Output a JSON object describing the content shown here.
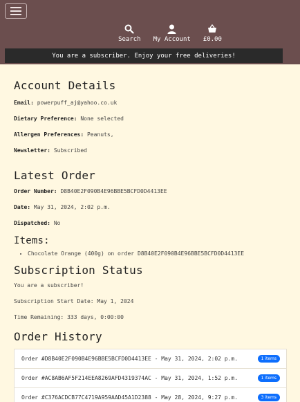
{
  "header": {
    "nav": [
      {
        "label": "Search",
        "icon": "search-icon"
      },
      {
        "label": "My Account",
        "icon": "user-icon"
      },
      {
        "label": "£0.00",
        "icon": "basket-icon"
      }
    ],
    "banner": "You are a subscriber. Enjoy your free deliveries!"
  },
  "account": {
    "title": "Account Details",
    "email_label": "Email:",
    "email": "powerpuff_aj@yahoo.co.uk",
    "diet_label": "Dietary Preference:",
    "diet": "None selected",
    "allergen_label": "Allergen Preferences:",
    "allergen": "Peanuts,",
    "newsletter_label": "Newsletter:",
    "newsletter": "Subscribed"
  },
  "latest_order": {
    "title": "Latest Order",
    "number_label": "Order Number:",
    "number": "D8B40E2F090B4E96BBE5BCFD0D4413EE",
    "date_label": "Date:",
    "date": "May 31, 2024, 2:02 p.m.",
    "dispatched_label": "Dispatched:",
    "dispatched": "No",
    "items_title": "Items:",
    "items": [
      "Chocolate Orange (400g) on order D8B40E2F090B4E96BBE5BCFD0D4413EE"
    ]
  },
  "subscription": {
    "title": "Subscription Status",
    "status": "You are a subscriber!",
    "start": "Subscription Start Date: May 1, 2024",
    "remaining": "Time Remaining: 333 days, 0:00:00"
  },
  "history": {
    "title": "Order History",
    "orders": [
      {
        "text": "Order #D8B40E2F090B4E96BBE5BCFD0D4413EE - May 31, 2024, 2:02 p.m.",
        "badge": "1 items"
      },
      {
        "text": "Order #AC8AB6AF5F214EEA8269AFD4319374AC - May 31, 2024, 1:52 p.m.",
        "badge": "1 items"
      },
      {
        "text": "Order #C376ACDCB77C4719A959AAD45A1D2388 - May 28, 2024, 9:27 p.m.",
        "badge": "3 items"
      }
    ]
  }
}
